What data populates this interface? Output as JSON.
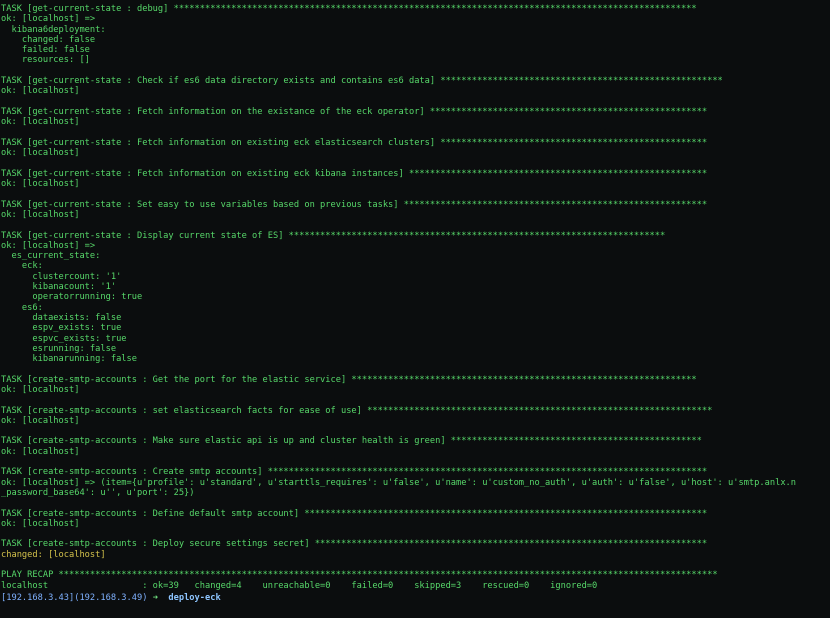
{
  "terminal": {
    "lines": [
      {
        "text": "TASK [get-current-state : debug] ****************************************************************************************************",
        "color": "green"
      },
      {
        "text": "ok: [localhost] =>",
        "color": "green"
      },
      {
        "text": "  kibana6deployment:",
        "color": "green"
      },
      {
        "text": "    changed: false",
        "color": "green"
      },
      {
        "text": "    failed: false",
        "color": "green"
      },
      {
        "text": "    resources: []",
        "color": "green"
      },
      {
        "text": "",
        "color": "blank"
      },
      {
        "text": "TASK [get-current-state : Check if es6 data directory exists and contains es6 data] ******************************************************",
        "color": "green"
      },
      {
        "text": "ok: [localhost]",
        "color": "green"
      },
      {
        "text": "",
        "color": "blank"
      },
      {
        "text": "TASK [get-current-state : Fetch information on the existance of the eck operator] *****************************************************",
        "color": "green"
      },
      {
        "text": "ok: [localhost]",
        "color": "green"
      },
      {
        "text": "",
        "color": "blank"
      },
      {
        "text": "TASK [get-current-state : Fetch information on existing eck elasticsearch clusters] ***************************************************",
        "color": "green"
      },
      {
        "text": "ok: [localhost]",
        "color": "green"
      },
      {
        "text": "",
        "color": "blank"
      },
      {
        "text": "TASK [get-current-state : Fetch information on existing eck kibana instances] *********************************************************",
        "color": "green"
      },
      {
        "text": "ok: [localhost]",
        "color": "green"
      },
      {
        "text": "",
        "color": "blank"
      },
      {
        "text": "TASK [get-current-state : Set easy to use variables based on previous tasks] **********************************************************",
        "color": "green"
      },
      {
        "text": "ok: [localhost]",
        "color": "green"
      },
      {
        "text": "",
        "color": "blank"
      },
      {
        "text": "TASK [get-current-state : Display current state of ES] ************************************************************************",
        "color": "green"
      },
      {
        "text": "ok: [localhost] =>",
        "color": "green"
      },
      {
        "text": "  es_current_state:",
        "color": "green"
      },
      {
        "text": "    eck:",
        "color": "green"
      },
      {
        "text": "      clustercount: '1'",
        "color": "green"
      },
      {
        "text": "      kibanacount: '1'",
        "color": "green"
      },
      {
        "text": "      operatorrunning: true",
        "color": "green"
      },
      {
        "text": "    es6:",
        "color": "green"
      },
      {
        "text": "      dataexists: false",
        "color": "green"
      },
      {
        "text": "      espv_exists: true",
        "color": "green"
      },
      {
        "text": "      espvc_exists: true",
        "color": "green"
      },
      {
        "text": "      esrunning: false",
        "color": "green"
      },
      {
        "text": "      kibanarunning: false",
        "color": "green"
      },
      {
        "text": "",
        "color": "blank"
      },
      {
        "text": "TASK [create-smtp-accounts : Get the port for the elastic service] ******************************************************************",
        "color": "green"
      },
      {
        "text": "ok: [localhost]",
        "color": "green"
      },
      {
        "text": "",
        "color": "blank"
      },
      {
        "text": "TASK [create-smtp-accounts : set elasticsearch facts for ease of use] ******************************************************************",
        "color": "green"
      },
      {
        "text": "ok: [localhost]",
        "color": "green"
      },
      {
        "text": "",
        "color": "blank"
      },
      {
        "text": "TASK [create-smtp-accounts : Make sure elastic api is up and cluster health is green] ************************************************",
        "color": "green"
      },
      {
        "text": "ok: [localhost]",
        "color": "green"
      },
      {
        "text": "",
        "color": "blank"
      },
      {
        "text": "TASK [create-smtp-accounts : Create smtp accounts] ************************************************************************************",
        "color": "green"
      },
      {
        "text": "ok: [localhost] => (item={u'profile': u'standard', u'starttls_requires': u'false', u'name': u'custom_no_auth', u'auth': u'false', u'host': u'smtp.anlx.n",
        "color": "green"
      },
      {
        "text": "_password_base64': u'', u'port': 25})",
        "color": "green"
      },
      {
        "text": "",
        "color": "blank"
      },
      {
        "text": "TASK [create-smtp-accounts : Define default smtp account] *****************************************************************************",
        "color": "green"
      },
      {
        "text": "ok: [localhost]",
        "color": "green"
      },
      {
        "text": "",
        "color": "blank"
      },
      {
        "text": "TASK [create-smtp-accounts : Deploy secure settings secret] ***************************************************************************",
        "color": "green"
      },
      {
        "text": "changed: [localhost]",
        "color": "yellow"
      },
      {
        "text": "",
        "color": "blank"
      },
      {
        "text": "PLAY RECAP ******************************************************************************************************************************",
        "color": "green"
      },
      {
        "text": "localhost                  : ok=39   changed=4    unreachable=0    failed=0    skipped=3    rescued=0    ignored=0",
        "color": "green"
      }
    ],
    "prompt": {
      "host": "[192.168.3.43](192.168.3.49)",
      "arrow": "➜",
      "dir": "deploy-eck"
    }
  }
}
